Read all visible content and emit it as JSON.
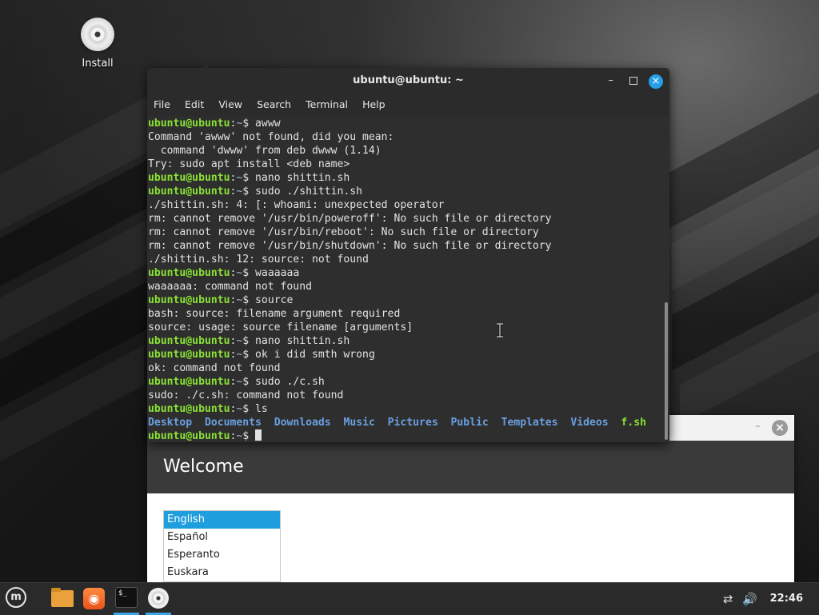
{
  "desktop": {
    "icons": [
      {
        "label": "Install",
        "icon": "disc-icon"
      }
    ]
  },
  "terminal": {
    "title": "ubuntu@ubuntu: ~",
    "menu": [
      "File",
      "Edit",
      "View",
      "Search",
      "Terminal",
      "Help"
    ],
    "prompt_user": "ubuntu@ubuntu",
    "prompt_sep": ":",
    "prompt_path": "~",
    "prompt_sign": "$ ",
    "lines": [
      {
        "type": "prompt",
        "cmd": "awww"
      },
      {
        "type": "out",
        "text": "Command 'awww' not found, did you mean:"
      },
      {
        "type": "out",
        "text": "  command 'dwww' from deb dwww (1.14)"
      },
      {
        "type": "out",
        "text": "Try: sudo apt install <deb name>"
      },
      {
        "type": "prompt",
        "cmd": "nano shittin.sh"
      },
      {
        "type": "prompt",
        "cmd": "sudo ./shittin.sh"
      },
      {
        "type": "out",
        "text": "./shittin.sh: 4: [: whoami: unexpected operator"
      },
      {
        "type": "out",
        "text": "rm: cannot remove '/usr/bin/poweroff': No such file or directory"
      },
      {
        "type": "out",
        "text": "rm: cannot remove '/usr/bin/reboot': No such file or directory"
      },
      {
        "type": "out",
        "text": "rm: cannot remove '/usr/bin/shutdown': No such file or directory"
      },
      {
        "type": "out",
        "text": "./shittin.sh: 12: source: not found"
      },
      {
        "type": "prompt",
        "cmd": "waaaaaa"
      },
      {
        "type": "out",
        "text": "waaaaaa: command not found"
      },
      {
        "type": "prompt",
        "cmd": "source"
      },
      {
        "type": "out",
        "text": "bash: source: filename argument required"
      },
      {
        "type": "out",
        "text": "source: usage: source filename [arguments]"
      },
      {
        "type": "prompt",
        "cmd": "nano shittin.sh"
      },
      {
        "type": "prompt",
        "cmd": "ok i did smth wrong"
      },
      {
        "type": "out",
        "text": "ok: command not found"
      },
      {
        "type": "prompt",
        "cmd": "sudo ./c.sh"
      },
      {
        "type": "out",
        "text": "sudo: ./c.sh: command not found"
      },
      {
        "type": "prompt",
        "cmd": "ls"
      },
      {
        "type": "ls",
        "items": [
          {
            "name": "Desktop",
            "kind": "dir"
          },
          {
            "name": "Documents",
            "kind": "dir"
          },
          {
            "name": "Downloads",
            "kind": "dir"
          },
          {
            "name": "Music",
            "kind": "dir"
          },
          {
            "name": "Pictures",
            "kind": "dir"
          },
          {
            "name": "Public",
            "kind": "dir"
          },
          {
            "name": "Templates",
            "kind": "dir"
          },
          {
            "name": "Videos",
            "kind": "dir"
          },
          {
            "name": "f.sh",
            "kind": "exe"
          }
        ]
      },
      {
        "type": "prompt",
        "cmd": "",
        "cursor": true
      }
    ]
  },
  "welcome": {
    "heading": "Welcome",
    "languages": [
      "English",
      "Español",
      "Esperanto",
      "Euskara"
    ],
    "selected_language": "English"
  },
  "taskbar": {
    "apps": [
      {
        "name": "menu",
        "icon": "linux-mint-menu-icon"
      },
      {
        "name": "files",
        "icon": "folder-icon"
      },
      {
        "name": "firefox",
        "icon": "firefox-icon"
      },
      {
        "name": "terminal",
        "icon": "terminal-icon",
        "active": true
      },
      {
        "name": "install",
        "icon": "disc-icon",
        "active": true
      }
    ],
    "clock": "22:46",
    "tray_icons": [
      "network-disconnected-icon",
      "volume-icon"
    ]
  },
  "colors": {
    "prompt_user": "#8ae234",
    "directory": "#6a9fe0",
    "accent": "#3aa5e8",
    "selection": "#1f9ede"
  }
}
